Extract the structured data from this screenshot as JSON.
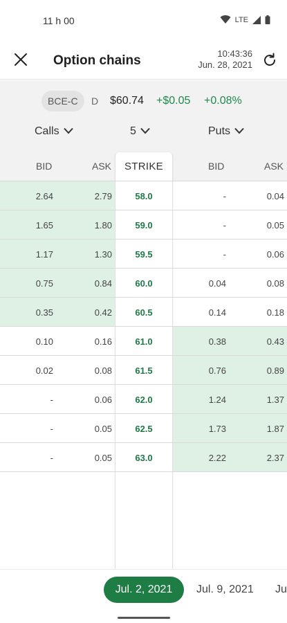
{
  "status": {
    "time": "11 h 00",
    "network": "LTE"
  },
  "header": {
    "title": "Option chains",
    "time": "10:43:36",
    "date": "Jun. 28, 2021"
  },
  "quote": {
    "symbol": "BCE-C",
    "exchange": "D",
    "price": "$60.74",
    "change": "+$0.05",
    "percent": "+0.08%"
  },
  "selectors": {
    "calls": "Calls",
    "count": "5",
    "puts": "Puts"
  },
  "columns": {
    "bid": "BID",
    "ask": "ASK",
    "strike": "STRIKE",
    "put_bid": "BID",
    "put_ask": "ASK"
  },
  "rows": [
    {
      "call_bid": "2.64",
      "call_ask": "2.79",
      "strike": "58.0",
      "put_bid": "-",
      "put_ask": "0.04",
      "call_itm": true,
      "put_itm": false
    },
    {
      "call_bid": "1.65",
      "call_ask": "1.80",
      "strike": "59.0",
      "put_bid": "-",
      "put_ask": "0.05",
      "call_itm": true,
      "put_itm": false
    },
    {
      "call_bid": "1.17",
      "call_ask": "1.30",
      "strike": "59.5",
      "put_bid": "-",
      "put_ask": "0.06",
      "call_itm": true,
      "put_itm": false
    },
    {
      "call_bid": "0.75",
      "call_ask": "0.84",
      "strike": "60.0",
      "put_bid": "0.04",
      "put_ask": "0.08",
      "call_itm": true,
      "put_itm": false
    },
    {
      "call_bid": "0.35",
      "call_ask": "0.42",
      "strike": "60.5",
      "put_bid": "0.14",
      "put_ask": "0.18",
      "call_itm": true,
      "put_itm": false
    },
    {
      "call_bid": "0.10",
      "call_ask": "0.16",
      "strike": "61.0",
      "put_bid": "0.38",
      "put_ask": "0.43",
      "call_itm": false,
      "put_itm": true
    },
    {
      "call_bid": "0.02",
      "call_ask": "0.08",
      "strike": "61.5",
      "put_bid": "0.76",
      "put_ask": "0.89",
      "call_itm": false,
      "put_itm": true
    },
    {
      "call_bid": "-",
      "call_ask": "0.06",
      "strike": "62.0",
      "put_bid": "1.24",
      "put_ask": "1.37",
      "call_itm": false,
      "put_itm": true
    },
    {
      "call_bid": "-",
      "call_ask": "0.05",
      "strike": "62.5",
      "put_bid": "1.73",
      "put_ask": "1.87",
      "call_itm": false,
      "put_itm": true
    },
    {
      "call_bid": "-",
      "call_ask": "0.05",
      "strike": "63.0",
      "put_bid": "2.22",
      "put_ask": "2.37",
      "call_itm": false,
      "put_itm": true
    }
  ],
  "expiries": [
    "Jul. 2, 2021",
    "Jul. 9, 2021",
    "Ju"
  ],
  "colors": {
    "accent": "#1e7d45",
    "in_the_money": "#dff0e5",
    "positive": "#1f8a4c"
  }
}
